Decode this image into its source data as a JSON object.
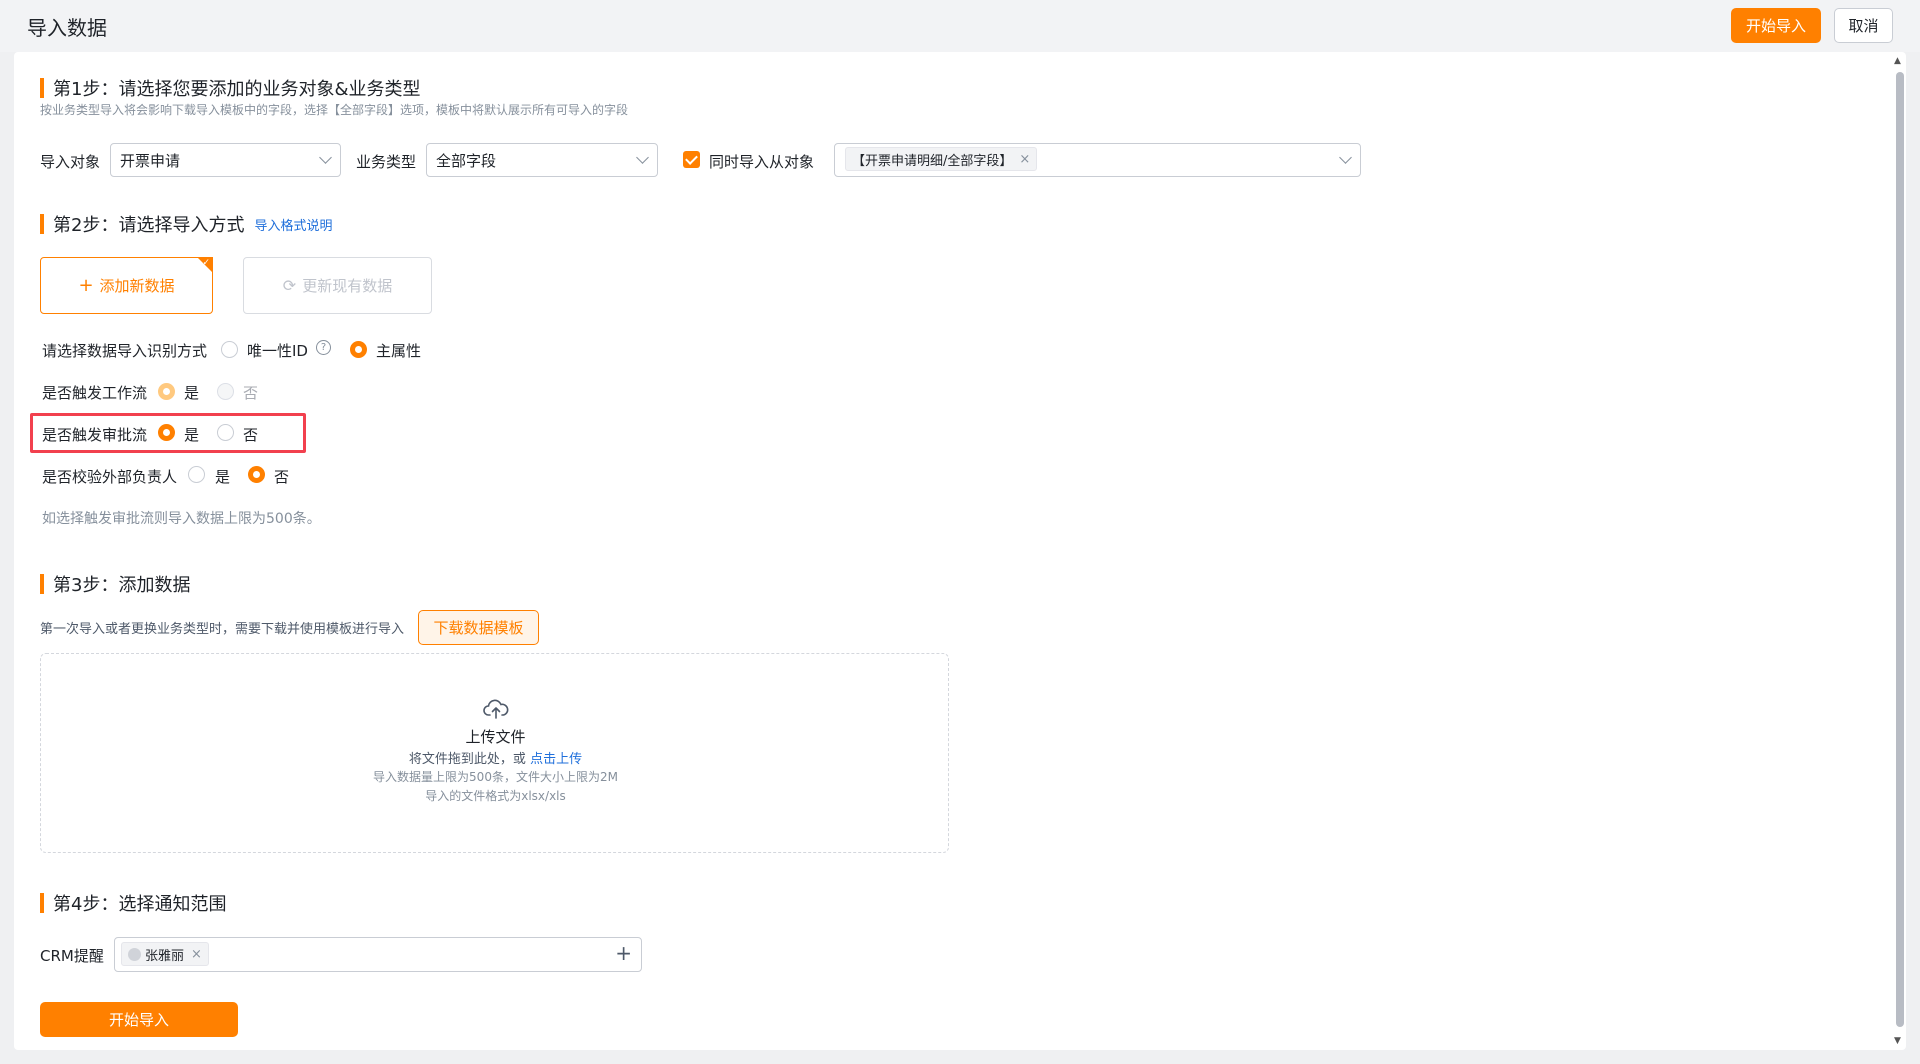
{
  "header": {
    "title": "导入数据",
    "start_label": "开始导入",
    "cancel_label": "取消"
  },
  "step1": {
    "title": "第1步：请选择您要添加的业务对象&业务类型",
    "hint": "按业务类型导入将会影响下载导入模板中的字段，选择【全部字段】选项，模板中将默认展示所有可导入的字段",
    "object_label": "导入对象",
    "object_value": "开票申请",
    "type_label": "业务类型",
    "type_value": "全部字段",
    "sub_checkbox_label": "同时导入从对象",
    "sub_checked": true,
    "sub_tag": "【开票申请明细/全部字段】"
  },
  "step2": {
    "title": "第2步：请选择导入方式",
    "format_link": "导入格式说明",
    "add_mode": "添加新数据",
    "update_mode": "更新现有数据",
    "identify_label": "请选择数据导入识别方式",
    "identify_opt1": "唯一性ID",
    "identify_opt2": "主属性",
    "workflow_label": "是否触发工作流",
    "approval_label": "是否触发审批流",
    "owner_label": "是否校验外部负责人",
    "yes": "是",
    "no": "否",
    "note": "如选择触发审批流则导入数据上限为500条。"
  },
  "step3": {
    "title": "第3步：添加数据",
    "hint": "第一次导入或者更换业务类型时，需要下载并使用模板进行导入",
    "download_label": "下载数据模板",
    "upload_title": "上传文件",
    "drag_text": "将文件拖到此处，或",
    "click_upload": "点击上传",
    "limit_text": "导入数据量上限为500条，文件大小上限为2M",
    "format_text": "导入的文件格式为xlsx/xls"
  },
  "step4": {
    "title": "第4步：选择通知范围",
    "crm_label": "CRM提醒",
    "member": "张雅丽"
  },
  "footer": {
    "start_label": "开始导入"
  },
  "colors": {
    "accent": "#ff8000",
    "link": "#1f6fdb",
    "highlight": "#f2404e"
  }
}
